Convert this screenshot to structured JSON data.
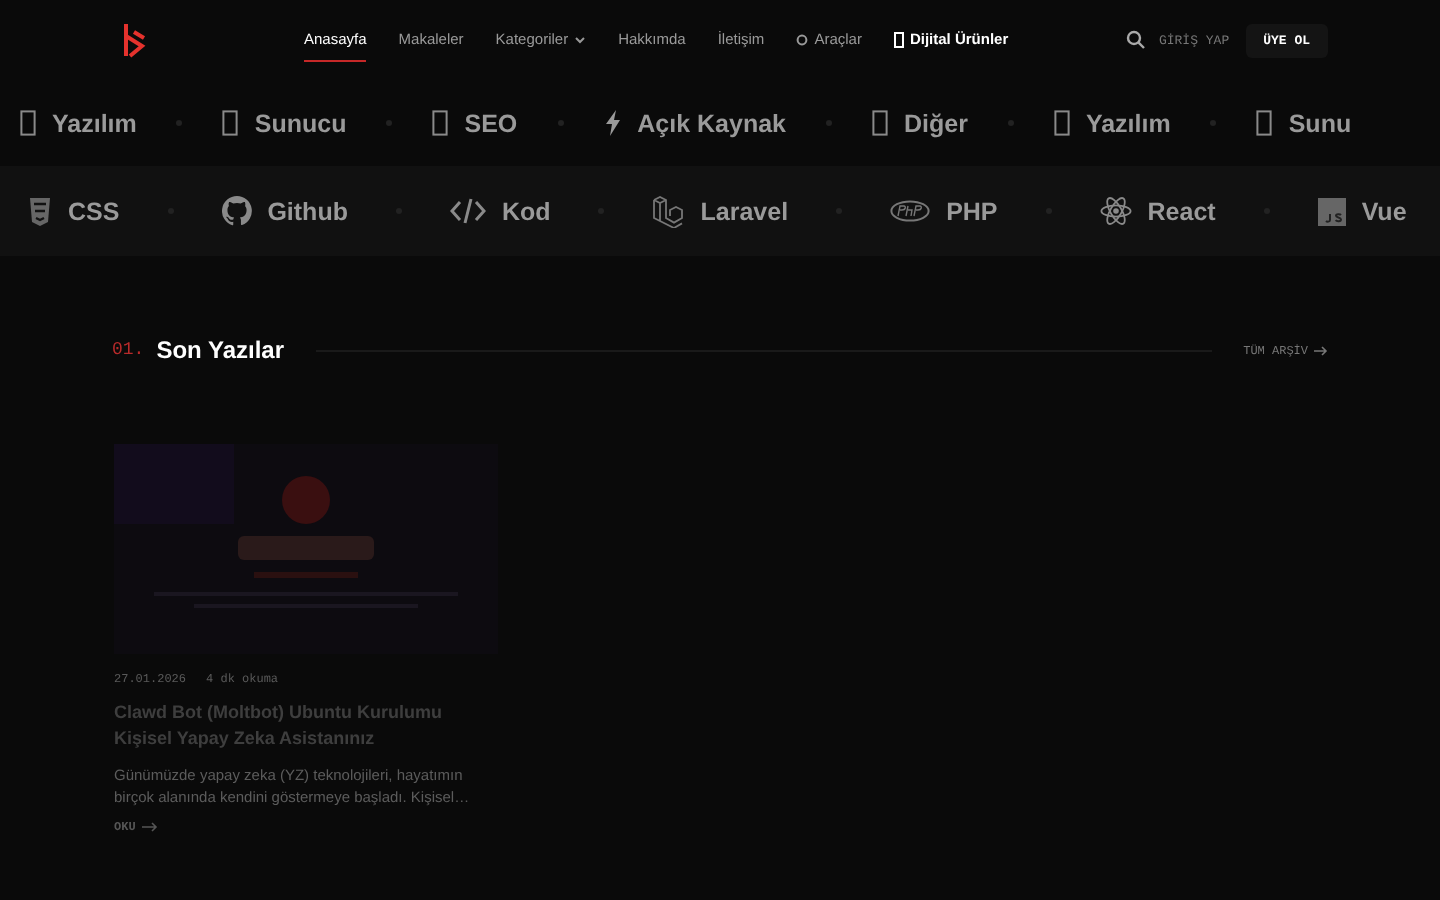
{
  "nav": {
    "links": [
      {
        "label": "Anasayfa",
        "selected": true,
        "kind": "link"
      },
      {
        "label": "Makaleler",
        "selected": false,
        "kind": "link"
      },
      {
        "label": "Kategoriler",
        "selected": false,
        "kind": "dropdown"
      },
      {
        "label": "Hakkımda",
        "selected": false,
        "kind": "link"
      },
      {
        "label": "İletişim",
        "selected": false,
        "kind": "link"
      },
      {
        "label": "Araçlar",
        "selected": false,
        "kind": "tool"
      },
      {
        "label": "Dijital Ürünler",
        "selected": false,
        "kind": "featured"
      }
    ],
    "login": "GİRİŞ YAP",
    "signup": "ÜYE OL"
  },
  "category_ticker": [
    "Yazılım",
    "Sunucu",
    "SEO",
    "Açık Kaynak",
    "Diğer",
    "Yazılım",
    "Sunu"
  ],
  "tech_ticker": [
    "CSS",
    "Github",
    "Kod",
    "Laravel",
    "PHP",
    "React",
    "Vue"
  ],
  "section": {
    "number": "01.",
    "title": "Son Yazılar",
    "archive_link": "TÜM ARŞİV"
  },
  "posts": [
    {
      "kind": "picture",
      "date": "27.01.2026",
      "read_time": "4 dk okuma",
      "title": "Clawd Bot (Moltbot) Ubuntu Kurulumu Kişisel Yapay Zeka Asistanınız",
      "excerpt": "Günümüzde yapay zeka (YZ) teknolojileri, hayatımın birçok alanında kendini göstermeye başladı. Kişisel…",
      "read_more": "OKU"
    }
  ]
}
